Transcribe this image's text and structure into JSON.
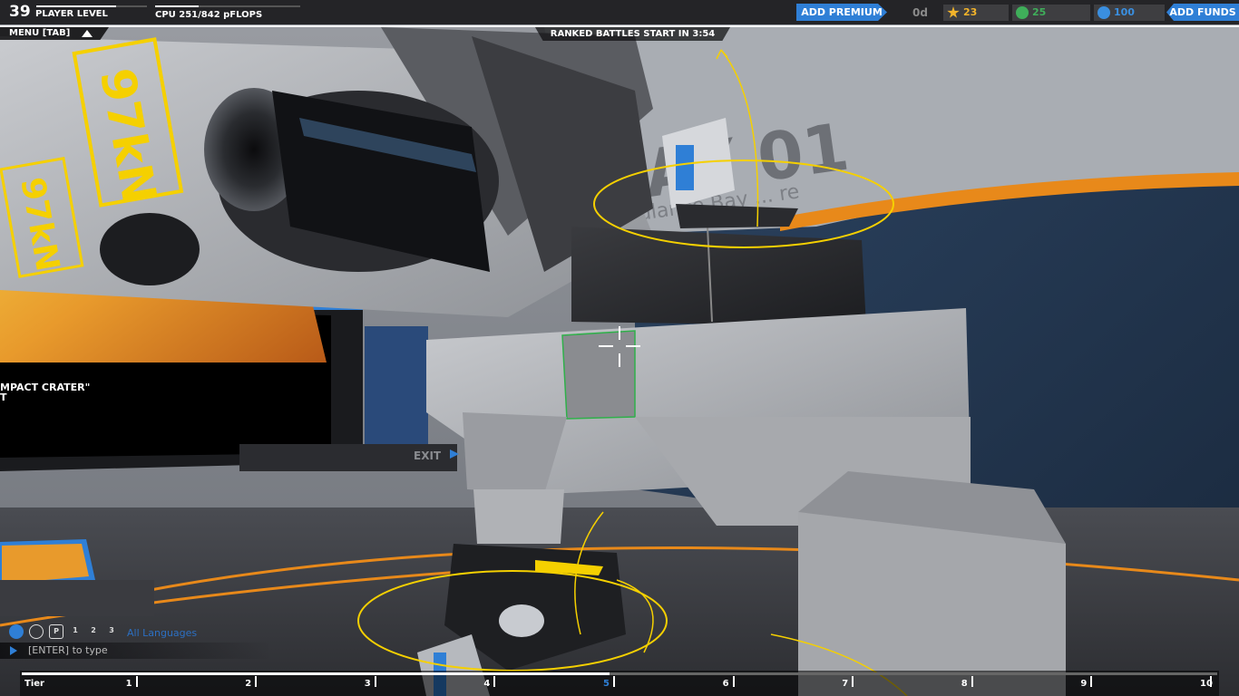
{
  "hud": {
    "player_level": "39",
    "player_level_label": "PLAYER LEVEL",
    "player_level_progress": 0.72,
    "cpu_label": "CPU 251/842 pFLOPS",
    "cpu_progress": 0.298,
    "add_premium_label": "ADD PREMIUM",
    "premium_days": "0d",
    "robits_stars": "23",
    "rp": "25",
    "galaxy_coins": "100",
    "add_funds_label": "ADD FUNDS",
    "menu_label": "MENU [TAB]",
    "ranked_timer": "RANKED BATTLES START IN 3:54"
  },
  "scene": {
    "thruster_label": "97kN",
    "thruster_label_small": "97kN",
    "screen_caption": "MPACT CRATER\"",
    "screen_caption_2": "T",
    "exit_sign": "EXIT",
    "bay_sign": "BAY 01",
    "bay_subtitle": "Ambulance Bay ... re"
  },
  "chat": {
    "icons": [
      "globe-icon",
      "accessibility-icon",
      "party-icon",
      "team-1-icon",
      "team-2-icon",
      "team-3-icon"
    ],
    "icon_labels": [
      "",
      "",
      "P",
      "1",
      "2",
      "3"
    ],
    "language_filter": "All Languages",
    "input_placeholder": "[ENTER] to type"
  },
  "tier_bar": {
    "label": "Tier",
    "ticks": [
      "1",
      "2",
      "3",
      "4",
      "5",
      "6",
      "7",
      "8",
      "9",
      "10"
    ],
    "active_tier": "5"
  },
  "colors": {
    "accent_blue": "#2f7fd6",
    "highlight_yellow": "#f5d000",
    "trim_orange": "#e8891a",
    "star_gold": "#f2b32a",
    "rp_green": "#3fae5a",
    "gc_blue": "#3a8fe0"
  }
}
